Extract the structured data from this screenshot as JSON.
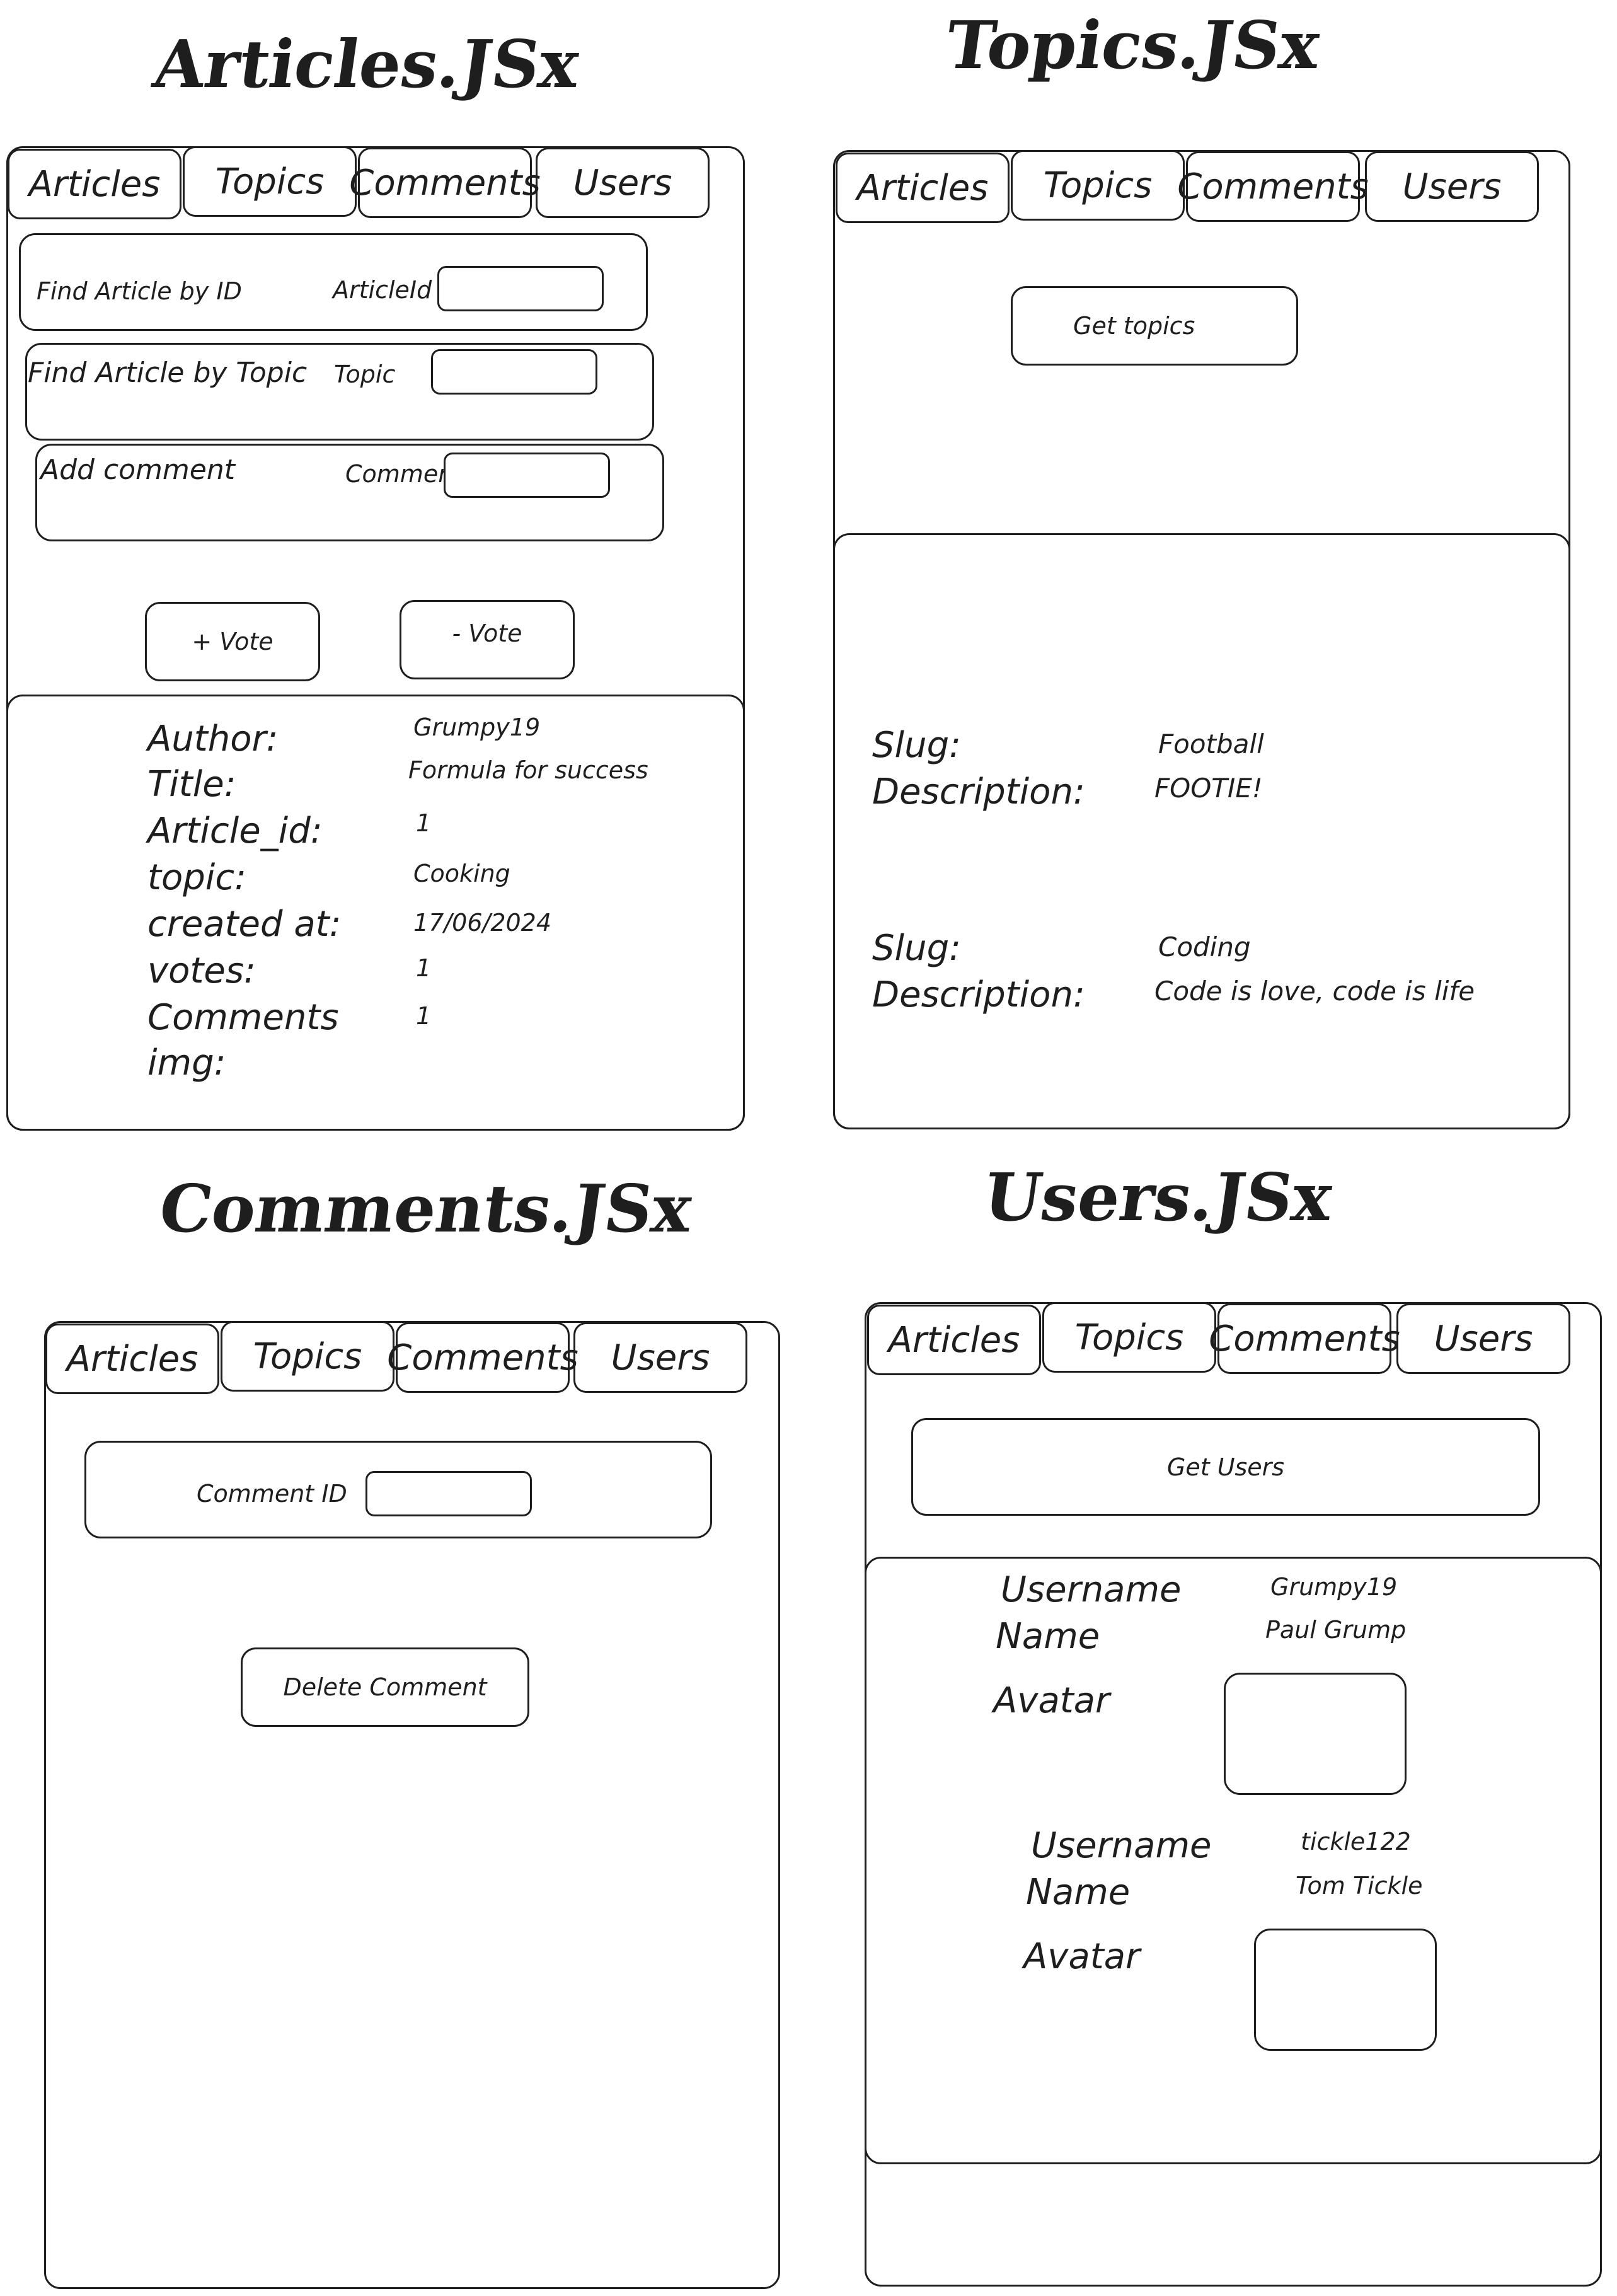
{
  "tabs": [
    "Articles",
    "Topics",
    "Comments",
    "Users"
  ],
  "articles": {
    "title": "Articles.JSx",
    "find_by_id": {
      "label": "Find Article by ID",
      "field_label": "ArticleId"
    },
    "find_by_topic": {
      "label": "Find Article by Topic",
      "field_label": "Topic"
    },
    "add_comment": {
      "label": "Add comment",
      "field_label": "Comment"
    },
    "vote_up": "+ Vote",
    "vote_down": "- Vote",
    "details": [
      {
        "label": "Author:",
        "value": "Grumpy19"
      },
      {
        "label": "Title:",
        "value": "Formula for success"
      },
      {
        "label": "Article_id:",
        "value": "1"
      },
      {
        "label": "topic:",
        "value": "Cooking"
      },
      {
        "label": "created at:",
        "value": "17/06/2024"
      },
      {
        "label": "votes:",
        "value": "1"
      },
      {
        "label": "Comments",
        "value": "1"
      },
      {
        "label": "img:",
        "value": ""
      }
    ]
  },
  "topics": {
    "title": "Topics.JSx",
    "get_button": "Get topics",
    "slug_label": "Slug:",
    "description_label": "Description:",
    "items": [
      {
        "slug": "Football",
        "description": "FOOTIE!"
      },
      {
        "slug": "Coding",
        "description": "Code is love, code is life"
      }
    ]
  },
  "comments": {
    "title": "Comments.JSx",
    "field_label": "Comment ID",
    "delete_button": "Delete Comment"
  },
  "users": {
    "title": "Users.JSx",
    "get_button": "Get Users",
    "username_label": "Username",
    "name_label": "Name",
    "avatar_label": "Avatar",
    "items": [
      {
        "username": "Grumpy19",
        "name": "Paul Grump"
      },
      {
        "username": "tickle122",
        "name": "Tom Tickle"
      }
    ]
  }
}
